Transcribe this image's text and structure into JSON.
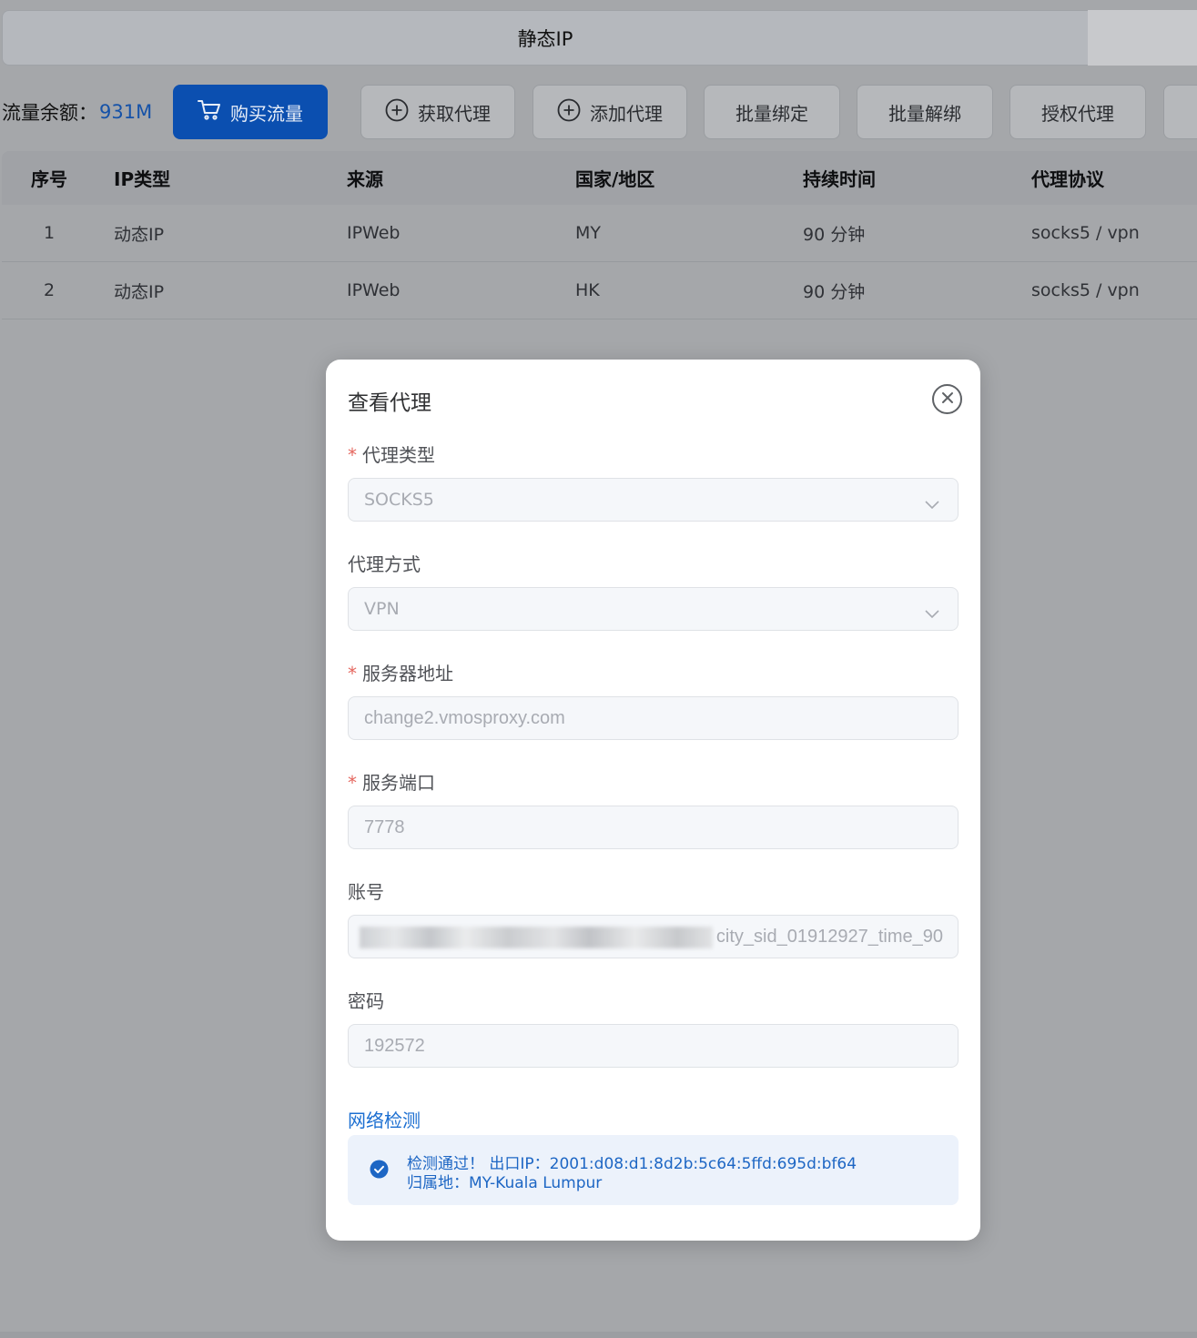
{
  "tabs": {
    "active_label": "静态IP"
  },
  "toolbar": {
    "balance_label": "流量余额：",
    "balance_value": "931M",
    "buy_label": "购买流量",
    "get_proxy_label": "获取代理",
    "add_proxy_label": "添加代理",
    "batch_bind_label": "批量绑定",
    "batch_unbind_label": "批量解绑",
    "authorize_label": "授权代理"
  },
  "table": {
    "headers": [
      "序号",
      "IP类型",
      "来源",
      "国家/地区",
      "持续时间",
      "代理协议"
    ],
    "rows": [
      [
        "1",
        "动态IP",
        "IPWeb",
        "MY",
        "90 分钟",
        "socks5 / vpn"
      ],
      [
        "2",
        "动态IP",
        "IPWeb",
        "HK",
        "90 分钟",
        "socks5 / vpn"
      ]
    ]
  },
  "dialog": {
    "title": "查看代理",
    "required_mark": "*",
    "proxy_type_label": "代理类型",
    "proxy_type_value": "SOCKS5",
    "proxy_mode_label": "代理方式",
    "proxy_mode_value": "VPN",
    "server_label": "服务器地址",
    "server_value": "change2.vmosproxy.com",
    "port_label": "服务端口",
    "port_value": "7778",
    "account_label": "账号",
    "account_value": "city_sid_01912927_time_90",
    "password_label": "密码",
    "password_value": "192572",
    "network_check_label": "网络检测",
    "check_line1": "检测通过！  出口IP：2001:d08:d1:8d2b:5c64:5ffd:695d:bf64",
    "check_line2": "归属地：MY-Kuala Lumpur"
  },
  "colors": {
    "primary": "#0b4fb0",
    "link": "#1c6fd1",
    "required": "#e5675f",
    "success_bg": "#ecf2fb"
  },
  "icons": [
    "cart-icon",
    "plus-circle-icon",
    "close-circle-icon",
    "chevron-down-icon",
    "check-circle-icon"
  ]
}
